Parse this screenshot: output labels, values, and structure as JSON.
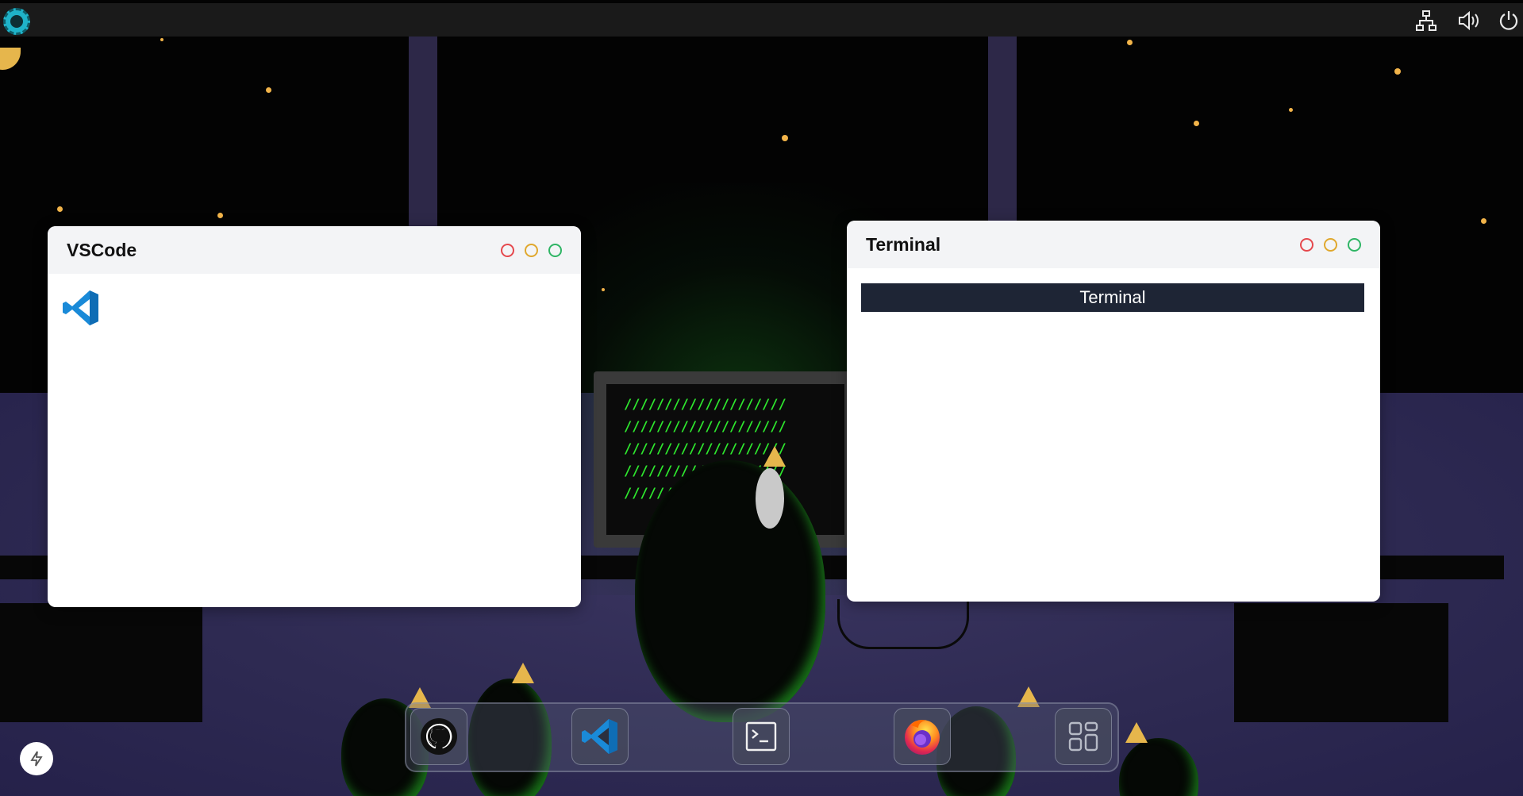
{
  "topbar": {
    "logo_icon": "linux-penguin-logo-icon",
    "tray": [
      {
        "icon": "network-icon"
      },
      {
        "icon": "volume-icon"
      },
      {
        "icon": "power-icon"
      }
    ]
  },
  "windows": {
    "vscode": {
      "title": "VSCode",
      "content_icon": "vscode-icon"
    },
    "terminal": {
      "title": "Terminal",
      "bar_text": "Terminal"
    }
  },
  "window_controls": {
    "close_color": "#e5484d",
    "minimize_color": "#e0a82e",
    "maximize_color": "#2fb565"
  },
  "wallpaper": {
    "monitor_text": "////////////////////\n////////////////////\n////////////////////\n////////////////////\n////////////////////"
  },
  "dock": {
    "items": [
      {
        "icon": "github-icon"
      },
      {
        "icon": "vscode-icon"
      },
      {
        "icon": "terminal-icon"
      },
      {
        "icon": "firefox-icon"
      },
      {
        "icon": "apps-grid-icon"
      }
    ]
  },
  "floating_button": {
    "icon": "flash-icon"
  }
}
